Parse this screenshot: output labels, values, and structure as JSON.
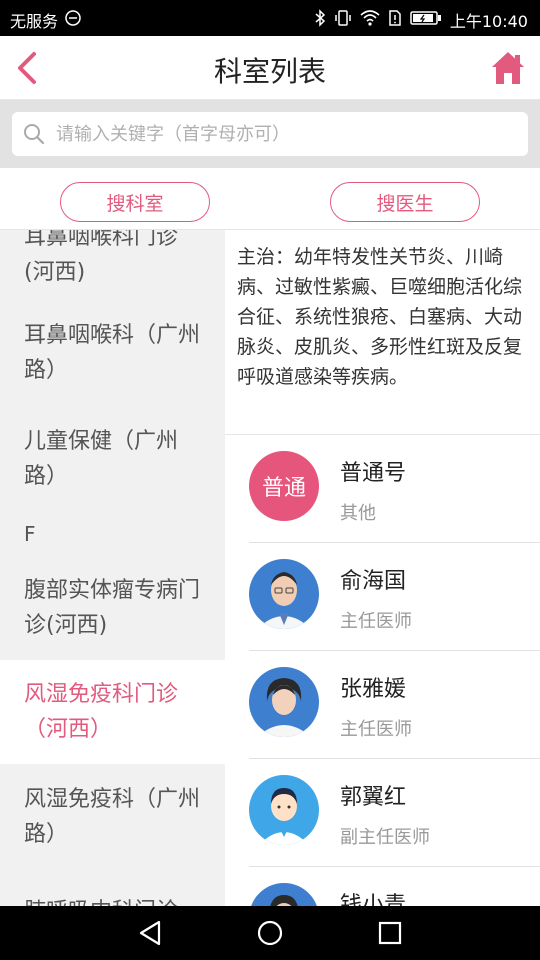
{
  "status_bar": {
    "carrier": "无服务",
    "time": "上午10:40"
  },
  "header": {
    "title": "科室列表",
    "back_icon": "chevron-left-icon",
    "home_icon": "home-icon",
    "accent_color": "#e35a7f"
  },
  "search": {
    "placeholder": "请输入关键字（首字母亦可）"
  },
  "search_buttons": {
    "dept_label": "搜科室",
    "doctor_label": "搜医生"
  },
  "departments": [
    {
      "label": "耳鼻咽喉科门诊(河西)"
    },
    {
      "label": "耳鼻咽喉科（广州路）"
    },
    {
      "label": "儿童保健（广州路）"
    },
    {
      "label": "F",
      "is_letter": true
    },
    {
      "label": "腹部实体瘤专病门诊(河西)"
    },
    {
      "label": "风湿免疫科门诊（河西）",
      "active": true
    },
    {
      "label": "风湿免疫科（广州路）"
    },
    {
      "label": "肺呼吸内科门诊(河西)"
    }
  ],
  "description": "主治：幼年特发性关节炎、川崎病、过敏性紫癜、巨噬细胞活化综合征、系统性狼疮、白塞病、大动脉炎、皮肌炎、多形性红斑及反复呼吸道感染等疾病。",
  "doctors": [
    {
      "name": "普通号",
      "title": "其他",
      "avatar_text": "普通"
    },
    {
      "name": "俞海国",
      "title": "主任医师"
    },
    {
      "name": "张雅媛",
      "title": "主任医师"
    },
    {
      "name": "郭翼红",
      "title": "副主任医师"
    },
    {
      "name": "钱小青",
      "title": ""
    }
  ]
}
